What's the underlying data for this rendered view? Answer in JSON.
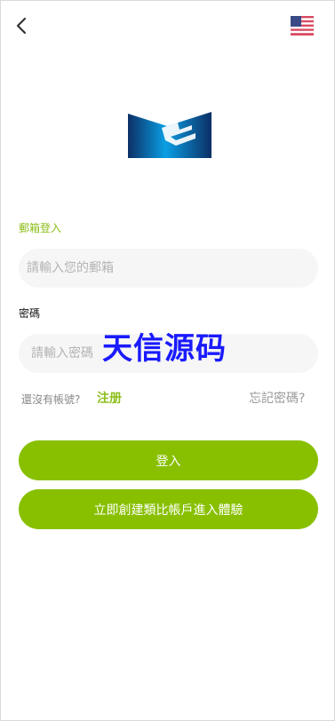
{
  "nav": {
    "back_icon": "chevron-left-icon",
    "language_flag_icon": "us-flag-icon"
  },
  "logo": {
    "icon": "brand-logo-mark"
  },
  "form": {
    "email_label": "郵箱登入",
    "email_placeholder": "請輸入您的郵箱",
    "email_value": "",
    "password_label": "密碼",
    "password_placeholder": "請輸入密碼",
    "password_value": ""
  },
  "watermark": {
    "text": "天信源码",
    "color": "#1a1aff"
  },
  "links": {
    "no_account": "還沒有帳號?",
    "register": "注册",
    "forgot_password": "忘記密碼?"
  },
  "buttons": {
    "login": "登入",
    "create_demo": "立即創建類比帳戶進入體驗"
  },
  "colors": {
    "accent": "#88c000",
    "label_accent": "#8cbf1a",
    "input_bg": "#f6f6f6"
  }
}
